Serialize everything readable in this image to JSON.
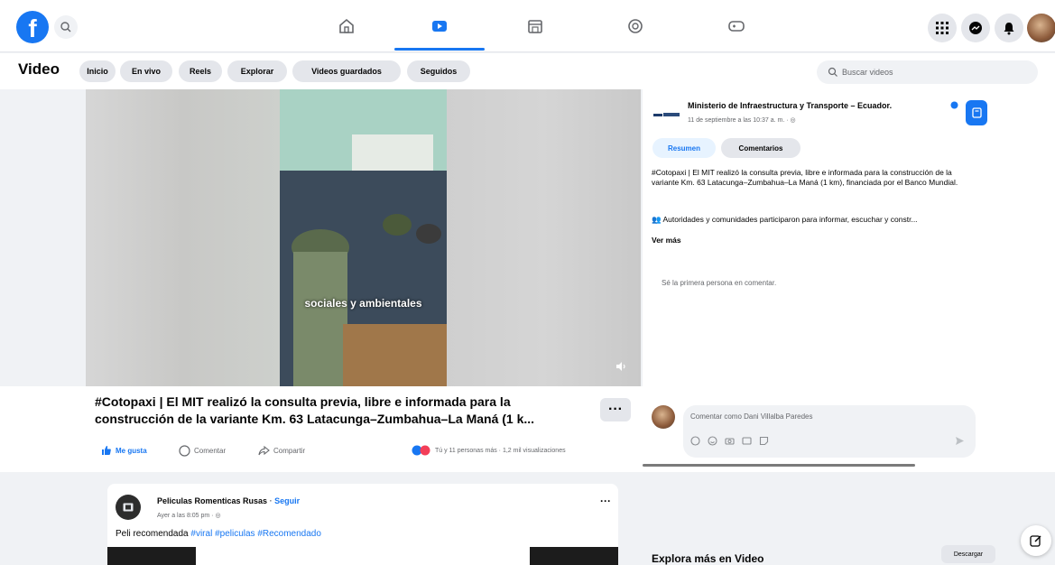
{
  "colors": {
    "accent": "#1877f2",
    "bg": "#f0f2f5"
  },
  "topnav": {
    "logo": "f",
    "icons": [
      "home-icon",
      "watch-icon",
      "marketplace-icon",
      "groups-icon",
      "gaming-icon"
    ],
    "right_icons": [
      "menu-grid-icon",
      "messenger-icon",
      "notifications-icon",
      "profile-avatar"
    ]
  },
  "subhead": {
    "title": "Video",
    "pills": [
      "Inicio",
      "En vivo",
      "Reels",
      "Explorar",
      "Videos guardados",
      "Seguidos"
    ],
    "search_placeholder": "Buscar videos"
  },
  "video": {
    "caption": "sociales y ambientales",
    "title": "#Cotopaxi | El MIT realizó la consulta previa, libre e informada para la construcción de la variante Km. 63 Latacunga–Zumbahua–La Maná (1 k...",
    "more": "···",
    "actions": {
      "like": "Me gusta",
      "comment": "Comentar",
      "share": "Compartir",
      "reactions": "Tú y 11 personas más · 1,2 mil visualizaciones"
    }
  },
  "right_panel": {
    "page_name": "Ministerio de Infraestructura y Transporte – Ecuador.",
    "timestamp": "11 de septiembre a las 10:37 a. m. · ",
    "tabs": [
      "Resumen",
      "Comentarios"
    ],
    "post_text_1": "#Cotopaxi | El MIT realizó la consulta previa, libre e informada para la construcción de la variante Km. 63 Latacunga–Zumbahua–La Maná (1 km), financiada por el Banco Mundial.",
    "post_text_2": "👥 Autoridades y comunidades participaron para informar, escuchar y constr...",
    "see_more": "Ver más",
    "first_comment": "Sé la primera persona en comentar.",
    "comment_placeholder": "Comentar como Dani Villalba Paredes"
  },
  "feed": {
    "page_name": "Peliculas Romenticas Rusas",
    "follow": "Seguir",
    "timestamp": "Ayer a las 8:05 pm · ",
    "text_plain": "Peli recomendada ",
    "hashtags": "#viral #peliculas #Recomendado",
    "more": "···"
  },
  "explore": {
    "title": "Explora más en Video",
    "download": "Descargar"
  }
}
